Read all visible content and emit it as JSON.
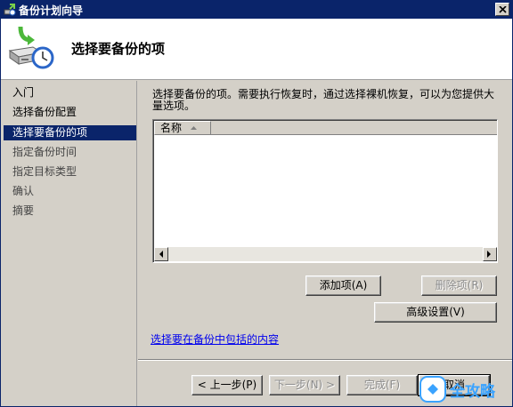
{
  "window": {
    "title": "备份计划向导"
  },
  "header": {
    "page_title": "选择要备份的项"
  },
  "sidebar": {
    "steps": [
      {
        "label": "入门"
      },
      {
        "label": "选择备份配置"
      },
      {
        "label": "选择要备份的项"
      },
      {
        "label": "指定备份时间"
      },
      {
        "label": "指定目标类型"
      },
      {
        "label": "确认"
      },
      {
        "label": "摘要"
      }
    ]
  },
  "main": {
    "description": "选择要备份的项。需要执行恢复时，通过选择裸机恢复，可以为您提供大量选项。",
    "list": {
      "columns": [
        {
          "label": "名称"
        }
      ],
      "rows": []
    },
    "add_item_label": "添加项(A)",
    "remove_item_label": "删除项(R)",
    "advanced_settings_label": "高级设置(V)",
    "include_link": "选择要在备份中包括的内容"
  },
  "footer": {
    "back_label": "< 上一步(P)",
    "next_label": "下一步(N) >",
    "finish_label": "完成(F)",
    "cancel_label": "取消"
  },
  "watermark": {
    "text": "全攻略"
  },
  "colors": {
    "titlebar": "#0a246a",
    "selection": "#0a246a",
    "face": "#d4d0c8",
    "link": "#0000ee"
  }
}
